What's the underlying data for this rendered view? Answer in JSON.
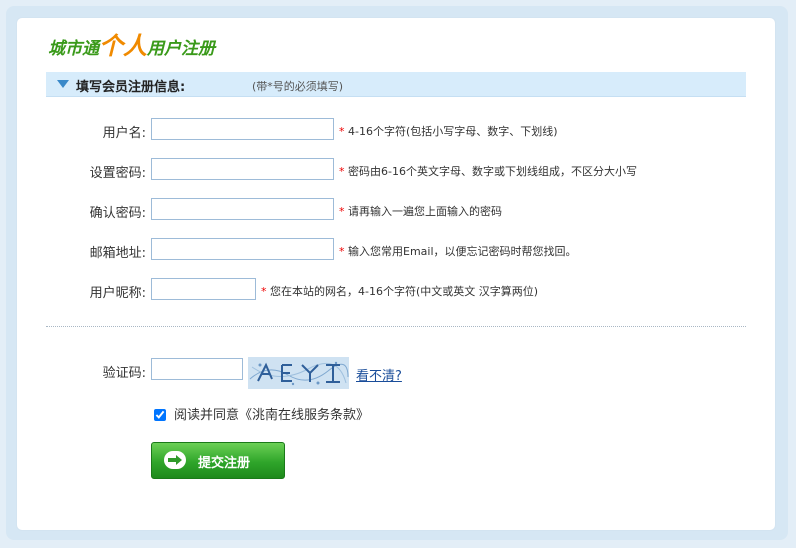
{
  "title": {
    "prefix": "城市通",
    "highlight": "个人",
    "suffix": "用户注册"
  },
  "section": {
    "heading": "填写会员注册信息:",
    "note": "(带*号的必须填写)"
  },
  "fields": [
    {
      "label": "用户名:",
      "value": "",
      "hint": "4-16个字符(包括小写字母、数字、下划线)"
    },
    {
      "label": "设置密码:",
      "value": "",
      "hint": "密码由6-16个英文字母、数字或下划线组成，不区分大小写"
    },
    {
      "label": "确认密码:",
      "value": "",
      "hint": "请再输入一遍您上面输入的密码"
    },
    {
      "label": "邮箱地址:",
      "value": "",
      "hint": "输入您常用Email，以便忘记密码时帮您找回。"
    },
    {
      "label": "用户昵称:",
      "value": "",
      "hint": "您在本站的网名，4-16个字符(中文或英文 汉字算两位)"
    }
  ],
  "star": "*",
  "captcha": {
    "label": "验证码:",
    "value": "",
    "refresh_link": "看不清?"
  },
  "agree": {
    "checked": true,
    "label": "阅读并同意《洮南在线服务条款》"
  },
  "submit_label": "提交注册"
}
